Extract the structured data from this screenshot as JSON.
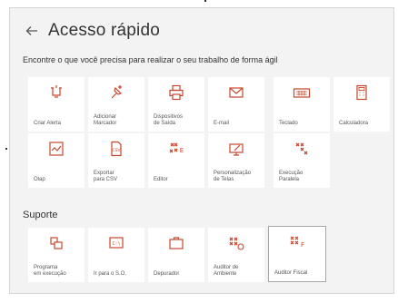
{
  "header": {
    "back_icon": "arrow-left-icon",
    "title": "Acesso rápido"
  },
  "subtitle": "Encontre o que você precisa para realizar o seu trabalho de forma ágil",
  "quick_tiles": [
    {
      "label": "Criar Alerta",
      "icon": "alert-icon"
    },
    {
      "label": "Adicionar\nMarcador",
      "icon": "pin-add-icon"
    },
    {
      "label": "Dispositivos\nde Saída",
      "icon": "printer-icon"
    },
    {
      "label": "E-mail",
      "icon": "mail-icon"
    },
    {
      "label": "Teclado",
      "icon": "keyboard-icon"
    },
    {
      "label": "Calculadora",
      "icon": "calculator-icon"
    },
    {
      "label": "Olap",
      "icon": "chart-icon"
    },
    {
      "label": "Exportar\npara CSV",
      "icon": "csv-icon"
    },
    {
      "label": "Editor",
      "icon": "editor-icon"
    },
    {
      "label": "Personalização\nde Telas",
      "icon": "customize-icon"
    },
    {
      "label": "Execução\nParalela",
      "icon": "parallel-icon"
    }
  ],
  "support": {
    "title": "Suporte",
    "tiles": [
      {
        "label": "Programa\nem execução",
        "icon": "program-icon"
      },
      {
        "label": "Ir para o S.O.",
        "icon": "terminal-icon"
      },
      {
        "label": "Depurador",
        "icon": "briefcase-icon"
      },
      {
        "label": "Auditor de\nAmbiente",
        "icon": "audit-env-icon"
      },
      {
        "label": "Auditor Fiscal",
        "icon": "audit-fiscal-icon"
      }
    ]
  },
  "colors": {
    "accent": "#c8462b",
    "tile_bg": "#ffffff",
    "panel_bg": "#f3f3f3"
  }
}
